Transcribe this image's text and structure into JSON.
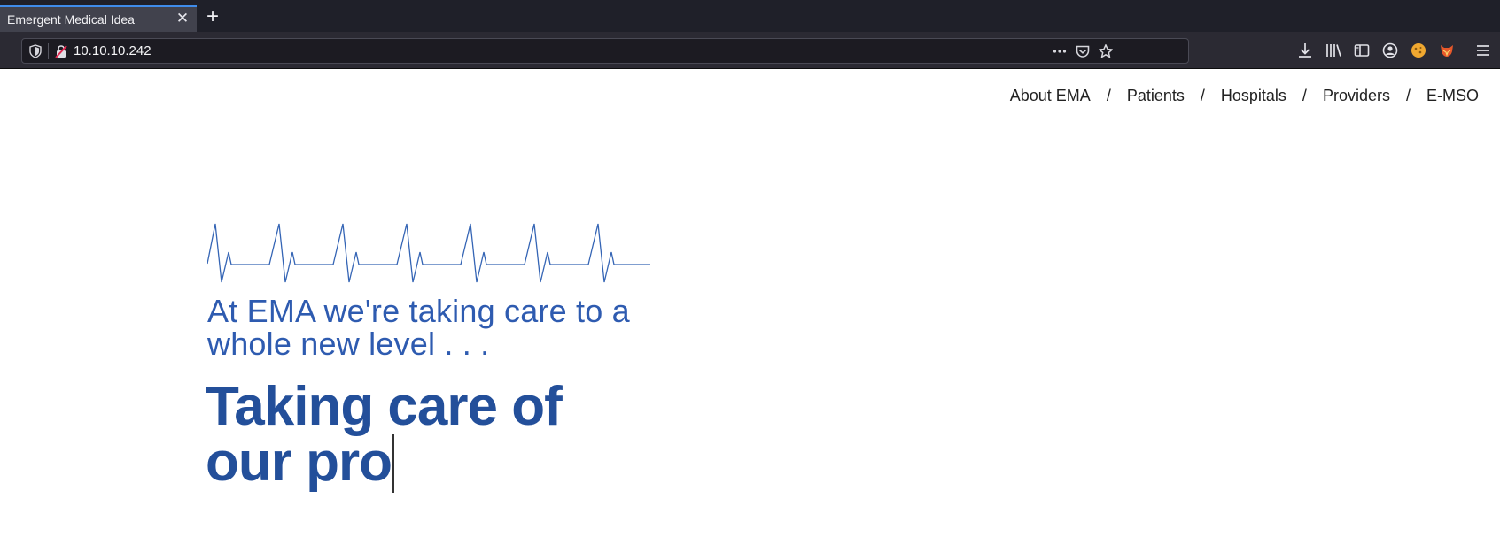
{
  "browser": {
    "tab_title": "Emergent Medical Idea",
    "tab_close_icon": "close-icon",
    "new_tab_icon": "plus-icon",
    "url": "10.10.10.242",
    "urlbar_icons": [
      "shield-icon",
      "insecure-lock-icon",
      "more-icon",
      "pocket-icon",
      "bookmark-star-icon"
    ],
    "toolbar_icons": [
      "download-icon",
      "library-icon",
      "sidebar-icon",
      "account-icon",
      "cookie-extension-icon",
      "fox-extension-icon",
      "menu-icon"
    ],
    "accent_color": "#3f8ceb"
  },
  "nav": {
    "items": [
      {
        "label": "About EMA"
      },
      {
        "label": "Patients"
      },
      {
        "label": "Hospitals"
      },
      {
        "label": "Providers"
      },
      {
        "label": "E-MSO"
      }
    ],
    "separator": "/"
  },
  "hero": {
    "tagline_line1": "At EMA we're taking care to a",
    "tagline_line2": "whole new level . . .",
    "headline_line1": "Taking care of",
    "headline_line2": "our pro",
    "tagline_color": "#2e5bb0",
    "headline_color": "#234f9a",
    "ekg_color": "#3565b5"
  }
}
